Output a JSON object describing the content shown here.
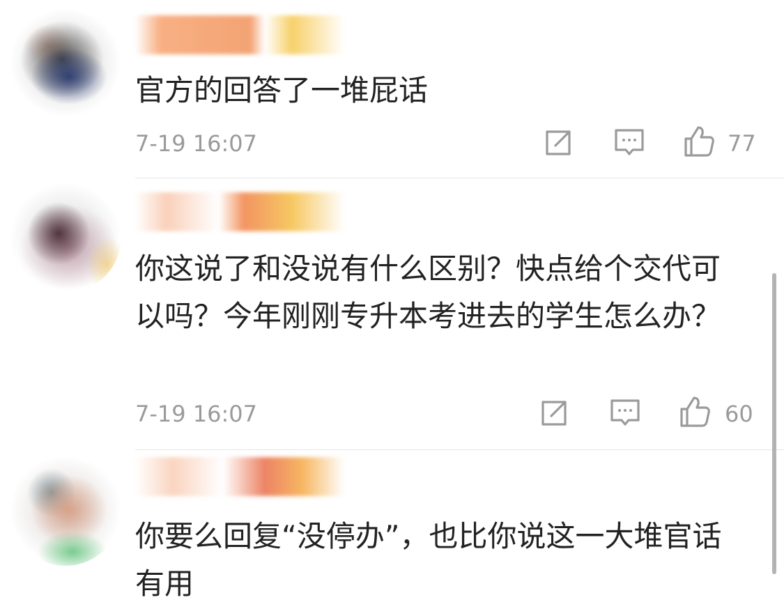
{
  "comments": [
    {
      "text": "官方的回答了一堆屁话",
      "time": "7-19 16:07",
      "likes": "77"
    },
    {
      "text": "你这说了和没说有什么区别？快点给个交代可以吗？今年刚刚专升本考进去的学生怎么办？",
      "time": "7-19 16:07",
      "likes": "60"
    },
    {
      "text": "你要么回复“没停办”，也比你说这一大堆官话有用"
    }
  ],
  "icons": {
    "share": "share-icon",
    "reply": "comment-icon",
    "like": "thumbs-up-icon"
  },
  "colors": {
    "text": "#222222",
    "meta": "#9a9a9a",
    "divider": "#e6e6e6",
    "scrollbar": "#b3b3b3"
  }
}
